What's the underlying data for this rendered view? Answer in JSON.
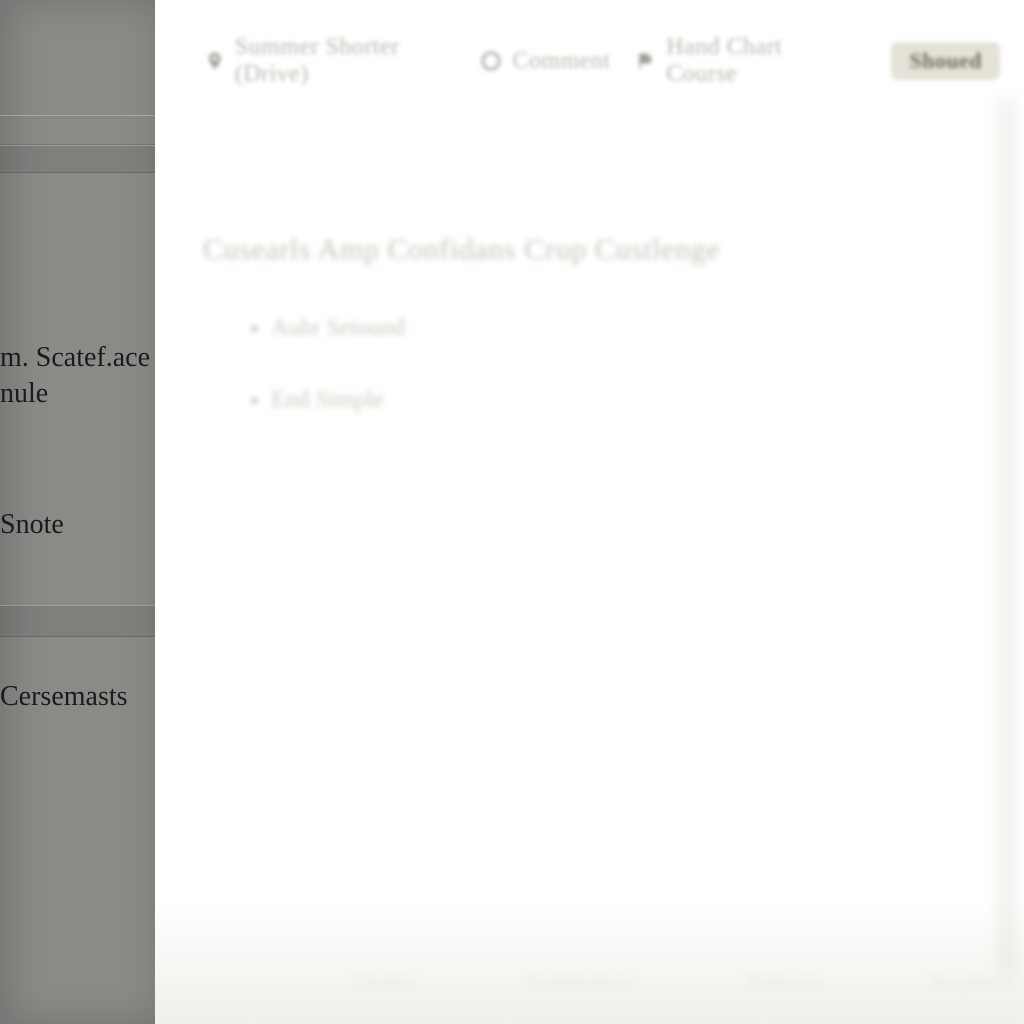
{
  "sidebar": {
    "items": [
      {
        "line1": "m. Scatef.ace",
        "line2": "nule"
      },
      {
        "label": "Snote"
      },
      {
        "label": "Cersemasts"
      }
    ]
  },
  "toolbar": {
    "item1_label": "Summer Shorter (Drive)",
    "item2_label": "Comment",
    "item3_label": "Hand Chart Course",
    "button_label": "Shoued"
  },
  "page": {
    "title": "Cusearls  Amp  Confidans  Crup Custlenge",
    "bullets": [
      "Auhr Setound",
      "End Simple"
    ],
    "footer": {
      "a": "Oerten",
      "b": "Commahens",
      "c": "Portosin",
      "d": "Soarmins"
    }
  }
}
